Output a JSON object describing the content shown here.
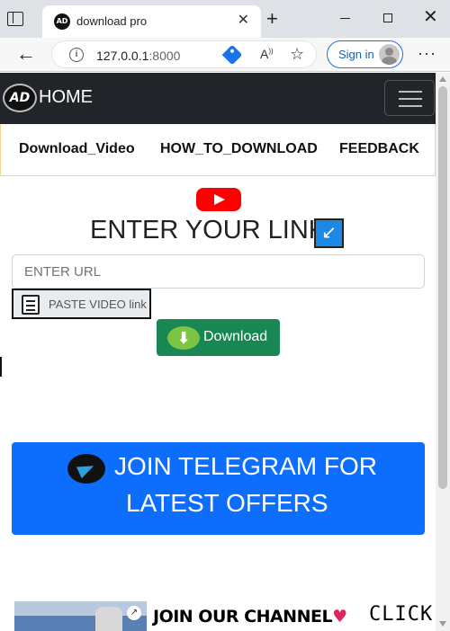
{
  "browser": {
    "tab_title": "download pro",
    "url_host": "127.0.0.1",
    "url_port": ":8000",
    "sign_in_label": "Sign in",
    "icons": [
      "tab-actions-icon",
      "favicon-icon",
      "close-icon",
      "plus-icon",
      "minimize-icon",
      "maximize-icon",
      "back-arrow-icon",
      "info-icon",
      "tag-icon",
      "read-aloud-icon",
      "favorites-icon",
      "avatar-icon",
      "more-icon"
    ]
  },
  "navbar": {
    "logo_text": "AD",
    "brand": "HOME",
    "bg_color": "#212529"
  },
  "menu": {
    "items": [
      {
        "label": "Download_Video"
      },
      {
        "label": "HOW_TO_DOWNLOAD"
      },
      {
        "label": "FEEDBACK"
      }
    ]
  },
  "main": {
    "heading": "ENTER YOUR LINK",
    "arrow_glyph": "↙",
    "url_placeholder": "ENTER URL",
    "paste_label": "PASTE VIDEO link",
    "download_label": "Download",
    "download_glyph": "⬇",
    "download_color": "#198754"
  },
  "telegram": {
    "line1": "JOIN TELEGRAM FOR",
    "line2": "LATEST OFFERS",
    "color": "#0d6efd"
  },
  "footer": {
    "channel_text": "JOIN OUR CHANNEL",
    "heart": "♥",
    "click_text": "CLICK"
  }
}
